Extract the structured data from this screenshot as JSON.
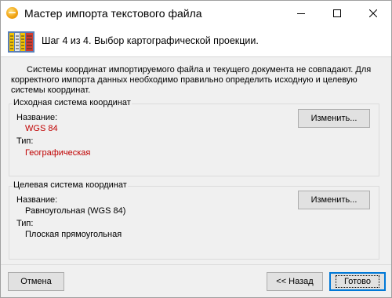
{
  "window": {
    "title": "Мастер импорта текстового файла",
    "controls": {
      "minimize_icon": "minimize-icon",
      "maximize_icon": "maximize-icon",
      "close_icon": "close-icon"
    }
  },
  "header": {
    "step_text": "Шаг 4 из 4. Выбор картографической проекции."
  },
  "description": "Системы координат импортируемого файла и текущего документа не совпадают. Для корректного импорта данных необходимо правильно определить исходную и целевую системы координат.",
  "source_system": {
    "legend": "Исходная система координат",
    "name_label": "Название:",
    "name_value": "WGS 84",
    "type_label": "Тип:",
    "type_value": "Географическая",
    "change_button": "Изменить..."
  },
  "target_system": {
    "legend": "Целевая система координат",
    "name_label": "Название:",
    "name_value": "Равноугольная (WGS 84)",
    "type_label": "Тип:",
    "type_value": "Плоская прямоугольная",
    "change_button": "Изменить..."
  },
  "footer": {
    "cancel_label": "Отмена",
    "back_label": "<< Назад",
    "finish_label": "Готово"
  },
  "colors": {
    "value_red": "#c00000",
    "window_bg": "#f0f0f0",
    "focus_blue": "#0078d7"
  }
}
